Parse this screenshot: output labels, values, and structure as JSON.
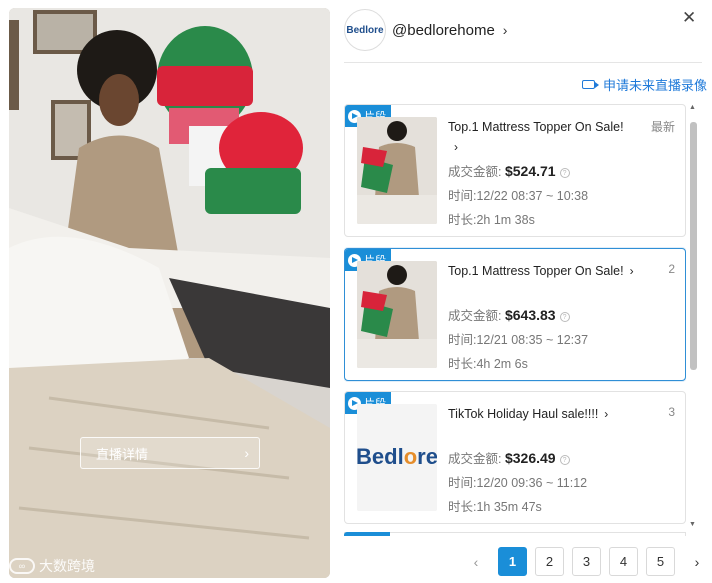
{
  "video": {
    "live_detail_label": "直播详情",
    "watermark": "大数跨境",
    "watermark_icon": "logo-icon"
  },
  "shop": {
    "logo_text": "Bedlore",
    "handle": "@bedlorehome",
    "close_icon": "close-icon"
  },
  "apply_record_label": "申请未来直播录像",
  "clips": [
    {
      "tag": "片段",
      "title": "Top.1 Mattress Topper On Sale!",
      "badge": "最新",
      "amount_label": "成交金额:",
      "amount": "$524.71",
      "time": "时间:12/22 08:37 ~ 10:38",
      "duration": "时长:2h 1m 38s"
    },
    {
      "tag": "片段",
      "title": "Top.1 Mattress Topper On Sale!",
      "badge": "2",
      "amount_label": "成交金额:",
      "amount": "$643.83",
      "time": "时间:12/21 08:35 ~ 12:37",
      "duration": "时长:4h 2m 6s"
    },
    {
      "tag": "片段",
      "title": "TikTok Holiday Haul sale!!!!",
      "badge": "3",
      "amount_label": "成交金额:",
      "amount": "$326.49",
      "time": "时间:12/20 09:36 ~ 11:12",
      "duration": "时长:1h 35m 47s"
    }
  ],
  "pagination": {
    "pages": [
      "1",
      "2",
      "3",
      "4",
      "5"
    ],
    "current": "1",
    "prev": "‹",
    "next": "›"
  },
  "colors": {
    "accent": "#1a8ed8",
    "link": "#1f7ad9"
  }
}
